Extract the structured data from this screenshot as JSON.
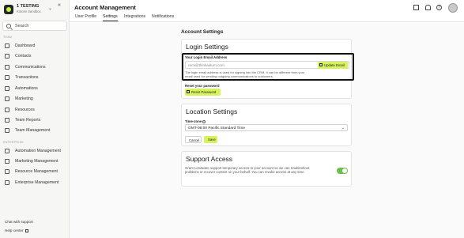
{
  "org": {
    "name": "1 TESTING",
    "subtitle": "Kotomi Sandbox"
  },
  "sidebar": {
    "search_label": "Search",
    "team_section": "TEAM",
    "team_items": [
      {
        "label": "Dashboard",
        "icon": "dashboard-icon"
      },
      {
        "label": "Contacts",
        "icon": "contacts-icon"
      },
      {
        "label": "Communications",
        "icon": "communications-icon"
      },
      {
        "label": "Transactions",
        "icon": "transactions-icon"
      },
      {
        "label": "Automations",
        "icon": "automations-icon"
      },
      {
        "label": "Marketing",
        "icon": "marketing-icon"
      },
      {
        "label": "Resources",
        "icon": "resources-icon"
      },
      {
        "label": "Team Reports",
        "icon": "reports-icon"
      },
      {
        "label": "Team Management",
        "icon": "team-icon"
      }
    ],
    "enterprise_section": "ENTERPRISE",
    "enterprise_items": [
      {
        "label": "Automation Management",
        "icon": "automation-mgmt-icon"
      },
      {
        "label": "Marketing Management",
        "icon": "marketing-mgmt-icon"
      },
      {
        "label": "Resource Management",
        "icon": "resource-mgmt-icon"
      },
      {
        "label": "Enterprise Management",
        "icon": "enterprise-mgmt-icon"
      }
    ],
    "chat_support": "Chat with support",
    "help_center": "Help center"
  },
  "header": {
    "title": "Account Management",
    "tabs": [
      {
        "label": "User Profile",
        "active": false
      },
      {
        "label": "Settings",
        "active": true
      },
      {
        "label": "Integrations",
        "active": false
      },
      {
        "label": "Notifications",
        "active": false
      }
    ]
  },
  "content": {
    "title": "Account Settings",
    "login": {
      "title": "Login Settings",
      "email_label": "Your Login Email Address",
      "email_value": "remi@thinkadium.com",
      "update_button": "Update Email",
      "help_line1": "The login email address is used for signing into the CRM. It can be different from your",
      "help_line2": "email used for sending outgoing communications to customers.",
      "reset_label": "Reset your password",
      "reset_button": "Reset Password"
    },
    "location": {
      "title": "Location Settings",
      "timezone_label": "Time-zone",
      "timezone_value": "GMT-08:00 Pacific Standard Time",
      "cancel_button": "Cancel",
      "save_button": "Save"
    },
    "support": {
      "title": "Support Access",
      "text_line1": "Grant Lendware support temporary access to your account so we can troubleshoot",
      "text_line2": "problems or recover content on your behalf. You can revoke access at any time.",
      "enabled": true
    }
  },
  "colors": {
    "accent": "#d4f35c",
    "toggle_on": "#6cc04a"
  }
}
